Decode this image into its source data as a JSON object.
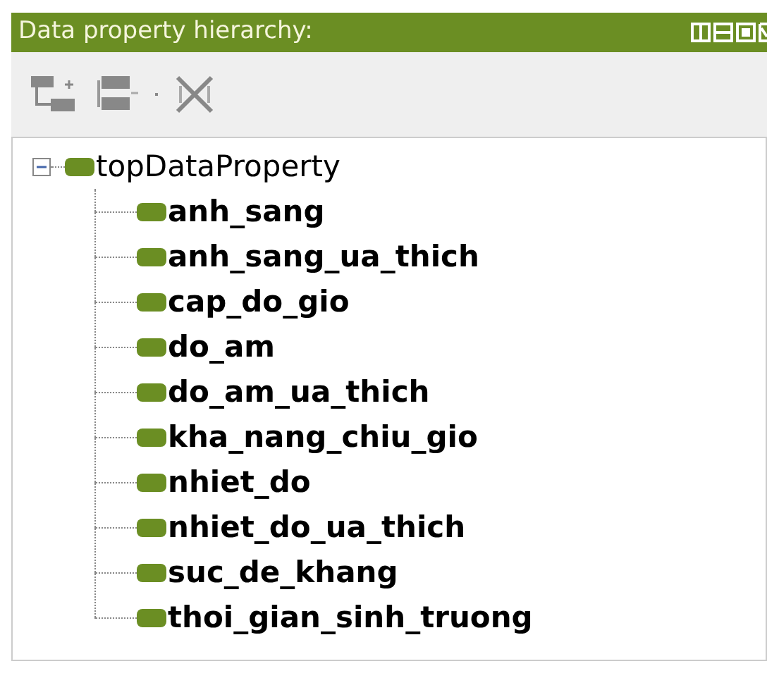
{
  "panel": {
    "title": "Data property hierarchy:"
  },
  "tree": [
    {
      "label": "topDataProperty",
      "expanded": true,
      "children": [
        {
          "label": "anh_sang"
        },
        {
          "label": "anh_sang_ua_thich"
        },
        {
          "label": "cap_do_gio"
        },
        {
          "label": "do_am"
        },
        {
          "label": "do_am_ua_thich"
        },
        {
          "label": "kha_nang_chiu_gio"
        },
        {
          "label": "nhiet_do"
        },
        {
          "label": "nhiet_do_ua_thich"
        },
        {
          "label": "suc_de_khang"
        },
        {
          "label": "thoi_gian_sinh_truong"
        }
      ]
    }
  ]
}
